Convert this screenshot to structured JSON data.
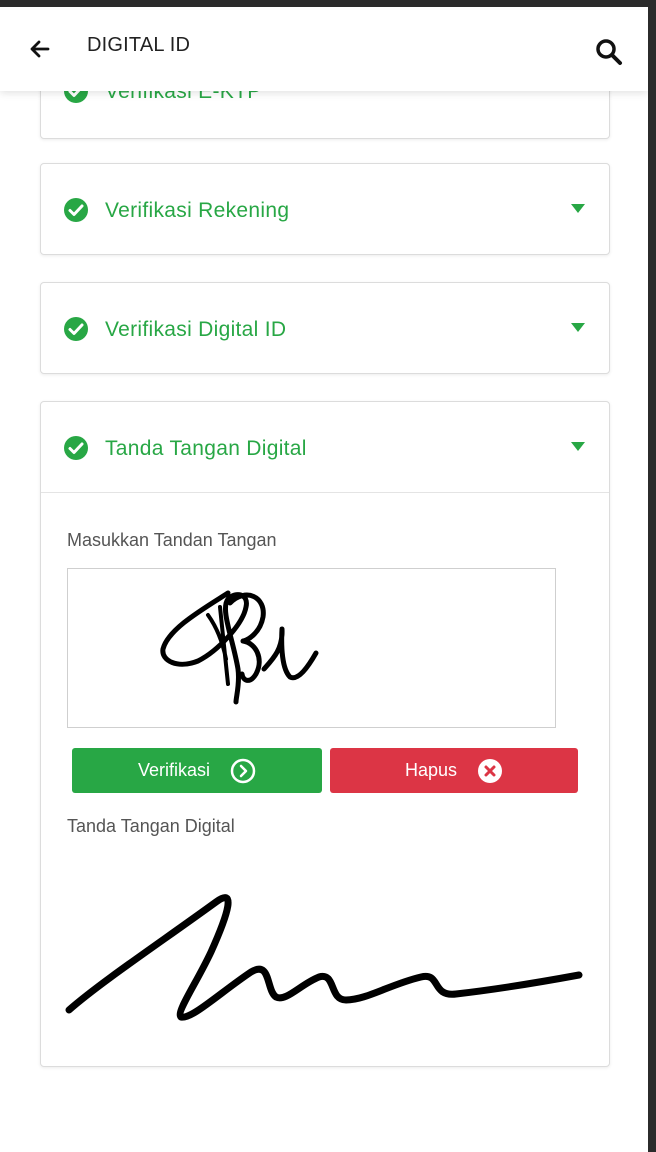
{
  "header": {
    "title": "DIGITAL ID",
    "back_icon": "arrow-left-icon",
    "search_icon": "search-icon"
  },
  "colors": {
    "accent_green": "#28a745",
    "danger_red": "#dc3545",
    "border": "#dcdcdc"
  },
  "sections": [
    {
      "title": "Verifikasi E-KTP",
      "status": "verified"
    },
    {
      "title": "Verifikasi Rekening",
      "status": "verified"
    },
    {
      "title": "Verifikasi Digital ID",
      "status": "verified"
    },
    {
      "title": "Tanda Tangan Digital",
      "status": "verified",
      "expanded": true
    }
  ],
  "signature": {
    "input_label": "Masukkan Tandan Tangan",
    "verify_label": "Verifikasi",
    "clear_label": "Hapus",
    "result_label": "Tanda Tangan Digital"
  }
}
